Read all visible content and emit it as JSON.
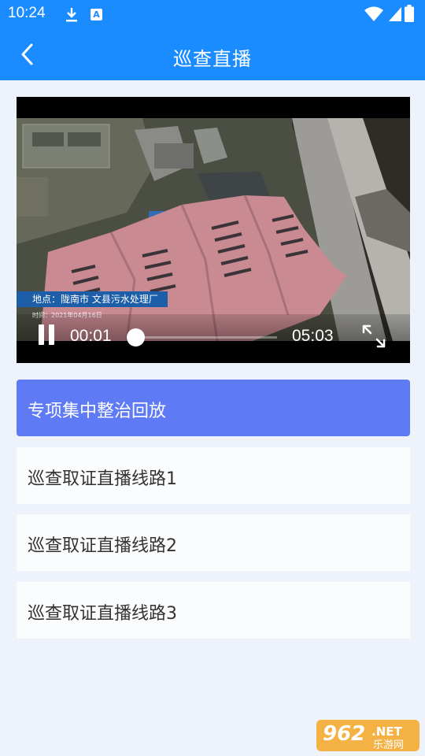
{
  "status_bar": {
    "time": "10:24",
    "a_badge": "A"
  },
  "header": {
    "title": "巡查直播"
  },
  "video": {
    "location_text": "地点：陇南市 文县污水处理厂",
    "time_text": "时间：2021年04月16日",
    "current_time": "00:01",
    "total_time": "05:03",
    "progress_fraction": 0.003
  },
  "list": {
    "items": [
      {
        "label": "专项集中整治回放",
        "active": true
      },
      {
        "label": "巡查取证直播线路1",
        "active": false
      },
      {
        "label": "巡查取证直播线路2",
        "active": false
      },
      {
        "label": "巡查取证直播线路3",
        "active": false
      }
    ]
  },
  "watermark": {
    "number": "962",
    "suffix": ".NET",
    "site": "乐游网"
  },
  "colors": {
    "primary": "#1a8cff",
    "active_item": "#5e7af5",
    "background": "#eef2fa"
  }
}
